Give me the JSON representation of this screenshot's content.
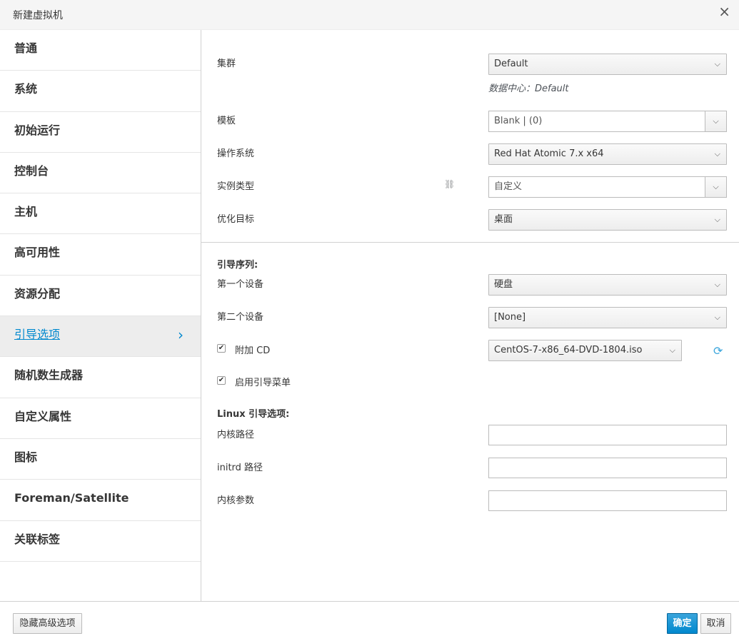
{
  "dialog": {
    "title": "新建虚拟机",
    "close": "×"
  },
  "sidebar": {
    "items": [
      {
        "label": "普通"
      },
      {
        "label": "系统"
      },
      {
        "label": "初始运行"
      },
      {
        "label": "控制台"
      },
      {
        "label": "主机"
      },
      {
        "label": "高可用性"
      },
      {
        "label": "资源分配"
      },
      {
        "label": "引导选项"
      },
      {
        "label": "随机数生成器"
      },
      {
        "label": "自定义属性"
      },
      {
        "label": "图标"
      },
      {
        "label": "Foreman/Satellite"
      },
      {
        "label": "关联标签"
      }
    ],
    "active_chevron": "›"
  },
  "form": {
    "cluster_label": "集群",
    "cluster_value": "Default",
    "datacenter_note": "数据中心：Default",
    "template_label": "模板",
    "template_value": "Blank |  (0)",
    "os_label": "操作系统",
    "os_value": "Red Hat Atomic 7.x x64",
    "instance_type_label": "实例类型",
    "instance_type_value": "自定义",
    "optimize_label": "优化目标",
    "optimize_value": "桌面",
    "boot_sequence_heading": "引导序列:",
    "first_device_label": "第一个设备",
    "first_device_value": "硬盘",
    "second_device_label": "第二个设备",
    "second_device_value": "[None]",
    "attach_cd_label": "附加 CD",
    "attach_cd_value": "CentOS-7-x86_64-DVD-1804.iso",
    "boot_menu_label": "启用引导菜单",
    "linux_boot_heading": "Linux 引导选项:",
    "kernel_path_label": "内核路径",
    "kernel_path_value": "",
    "initrd_path_label": "initrd 路径",
    "initrd_path_value": "",
    "kernel_params_label": "内核参数",
    "kernel_params_value": ""
  },
  "checks": {
    "attach_cd": true,
    "boot_menu": true,
    "mark": "✔"
  },
  "icons": {
    "caret": "⌵",
    "link": "⛓",
    "refresh": "⟳"
  },
  "footer": {
    "advanced_label": "隐藏高级选项",
    "ok_label": "确定",
    "cancel_label": "取消"
  },
  "colors": {
    "accent": "#0088ce",
    "primary_button": "#0088ce"
  }
}
